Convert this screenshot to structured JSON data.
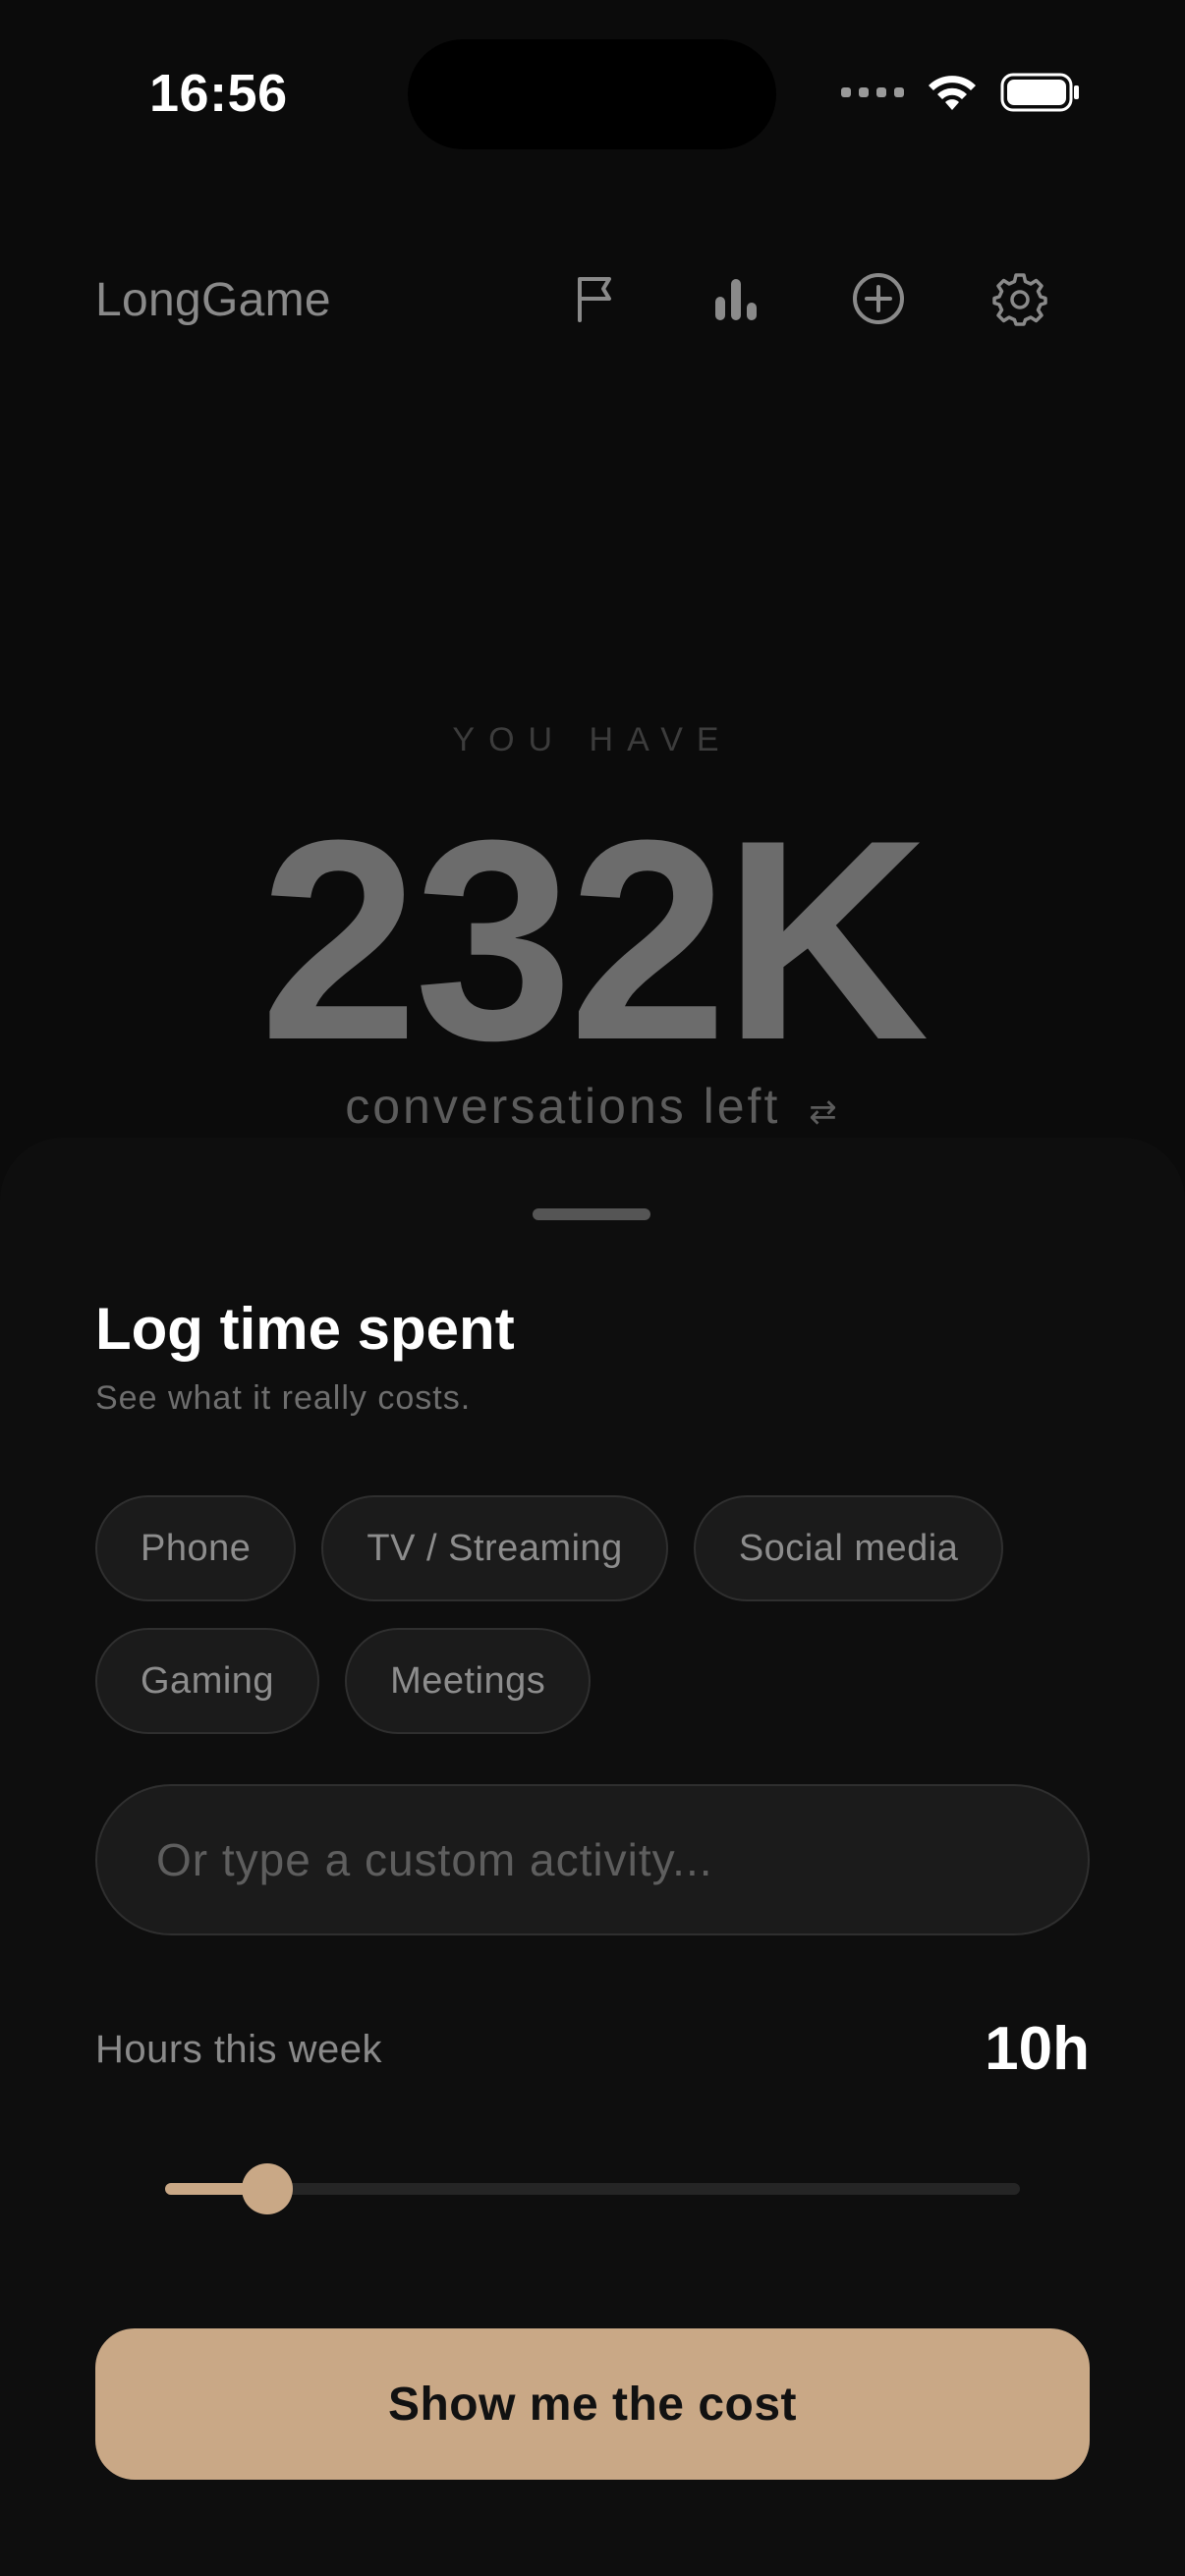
{
  "status_bar": {
    "time": "16:56"
  },
  "header": {
    "app_title": "LongGame",
    "icons": [
      "flag-icon",
      "bar-chart-icon",
      "plus-circle-icon",
      "gear-icon"
    ]
  },
  "hero": {
    "kicker": "YOU HAVE",
    "number": "232K",
    "subtitle": "conversations left",
    "swap_glyph": "⇄"
  },
  "sheet": {
    "title": "Log time spent",
    "subtitle": "See what it really costs.",
    "chips": [
      "Phone",
      "TV / Streaming",
      "Social media",
      "Gaming",
      "Meetings"
    ],
    "custom_placeholder": "Or type a custom activity...",
    "hours_label": "Hours this week",
    "hours_value": "10h",
    "slider_fraction": 0.12,
    "cta_label": "Show me the cost"
  },
  "colors": {
    "accent": "#c9a886",
    "background": "#0b0b0b",
    "sheet": "#0e0e0e"
  }
}
